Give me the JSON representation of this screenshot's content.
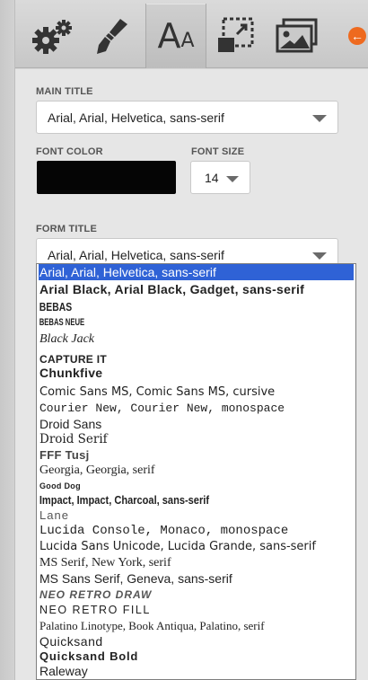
{
  "toolbar": {
    "tools": [
      {
        "name": "settings-icon"
      },
      {
        "name": "brush-icon"
      },
      {
        "name": "font-icon",
        "glyph": "A",
        "glyph_small": "A"
      },
      {
        "name": "resize-icon"
      },
      {
        "name": "image-icon"
      }
    ],
    "back_icon": "←"
  },
  "main_title": {
    "label": "MAIN TITLE",
    "value": "Arial, Arial, Helvetica, sans-serif"
  },
  "font_color": {
    "label": "FONT COLOR",
    "color": "#050505"
  },
  "font_size": {
    "label": "FONT SIZE",
    "value": "14"
  },
  "form_title": {
    "label": "FORM TITLE",
    "value": "Arial, Arial, Helvetica, sans-serif"
  },
  "font_options": [
    "Arial, Arial, Helvetica, sans-serif",
    "Arial Black, Arial Black, Gadget, sans-serif",
    "BEBAS",
    "BEBAS NEUE",
    "Black Jack",
    "CAPTURE IT",
    "Chunkfive",
    "Comic Sans MS, Comic Sans MS, cursive",
    "Courier New, Courier New, monospace",
    "Droid Sans",
    "Droid Serif",
    "FFF Tusj",
    "Georgia, Georgia, serif",
    "Good Dog",
    "Impact, Impact, Charcoal, sans-serif",
    "Lane",
    "Lucida Console, Monaco, monospace",
    "Lucida Sans Unicode, Lucida Grande, sans-serif",
    "MS Serif, New York, serif",
    "MS Sans Serif, Geneva, sans-serif",
    "NEO RETRO DRAW",
    "NEO RETRO FILL",
    "Palatino Linotype, Book Antiqua, Palatino, serif",
    "Quicksand",
    "Quicksand Bold",
    "Raleway"
  ],
  "colors": {
    "selected_option_bg": "#2f62d6",
    "back_button": "#ee6a1f"
  }
}
